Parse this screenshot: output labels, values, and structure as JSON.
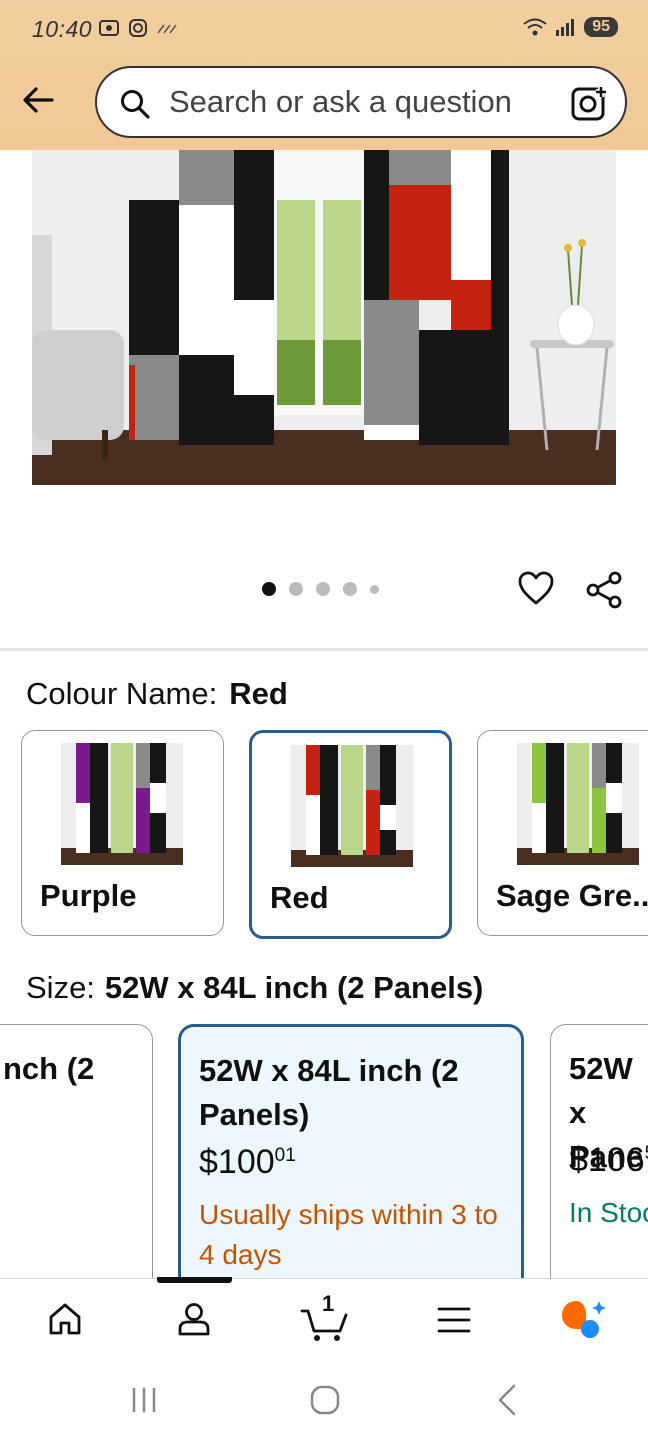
{
  "status_bar": {
    "time": "10:40",
    "battery": "95"
  },
  "search": {
    "placeholder": "Search or ask a question"
  },
  "carousel": {
    "image_count": 5,
    "active_index": 0
  },
  "colour": {
    "label": "Colour Name:",
    "selected": "Red",
    "options": [
      {
        "name": "Purple",
        "accent": "#7a1a8c"
      },
      {
        "name": "Red",
        "accent": "#d42a1a"
      },
      {
        "name": "Sage Gre..",
        "accent": "#8cc63f"
      }
    ]
  },
  "size": {
    "label": "Size:",
    "selected": "52W x 84L inch (2 Panels)",
    "options": [
      {
        "title": "nch (2",
        "price_main": "",
        "price_cents": "",
        "ship": ""
      },
      {
        "title": "52W x 84L inch (2 Panels)",
        "price_main": "$100",
        "price_cents": "01",
        "ship": "Usually ships within 3 to 4 days"
      },
      {
        "title": "52W x Pane",
        "price_main": "$106",
        "price_cents": "5",
        "ship": "In Stoc"
      }
    ]
  },
  "bottom_nav": {
    "cart_count": "1"
  },
  "colors": {
    "header_bg": "#f0c995",
    "selected_border": "#2a5c8a",
    "ship_orange": "#c45500",
    "in_stock_green": "#067d62"
  }
}
